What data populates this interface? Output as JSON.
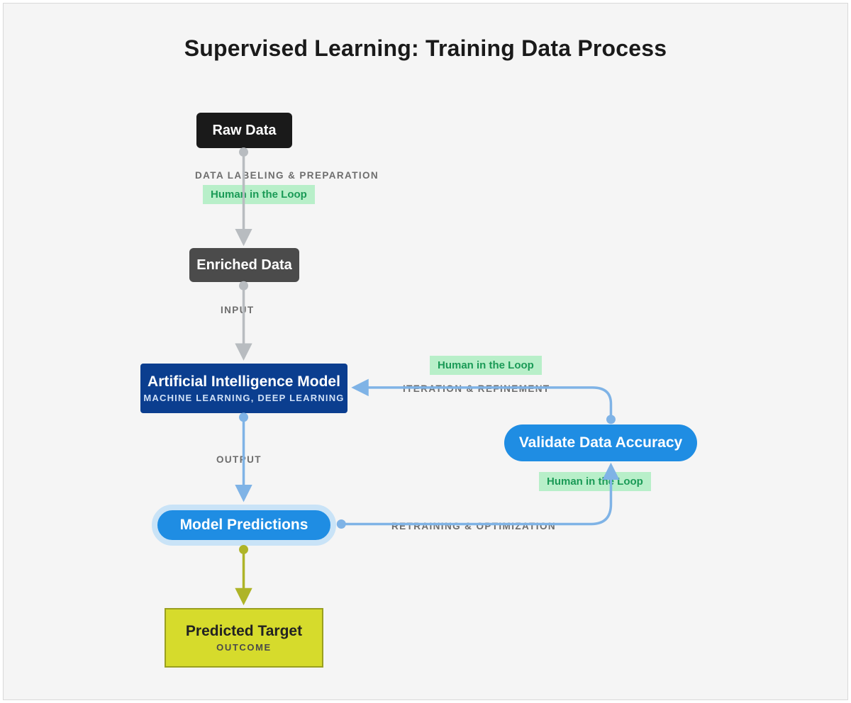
{
  "title": "Supervised Learning: Training Data Process",
  "nodes": {
    "raw": "Raw Data",
    "enriched": "Enriched Data",
    "model_title": "Artificial Intelligence Model",
    "model_sub": "MACHINE LEARNING, DEEP LEARNING",
    "predictions": "Model Predictions",
    "validate": "Validate Data Accuracy",
    "target_title": "Predicted Target",
    "target_sub": "OUTCOME"
  },
  "edges": {
    "label_preparation": "DATA LABELING & PREPARATION",
    "input": "INPUT",
    "output": "OUTPUT",
    "retrain": "RETRAINING & OPTIMIZATION",
    "iterate": "ITERATION & REFINEMENT"
  },
  "hitl": "Human in the Loop",
  "colors": {
    "grey_arrow": "#b8bcc0",
    "blue_arrow": "#7fb3e6",
    "olive_arrow": "#aeb428"
  }
}
